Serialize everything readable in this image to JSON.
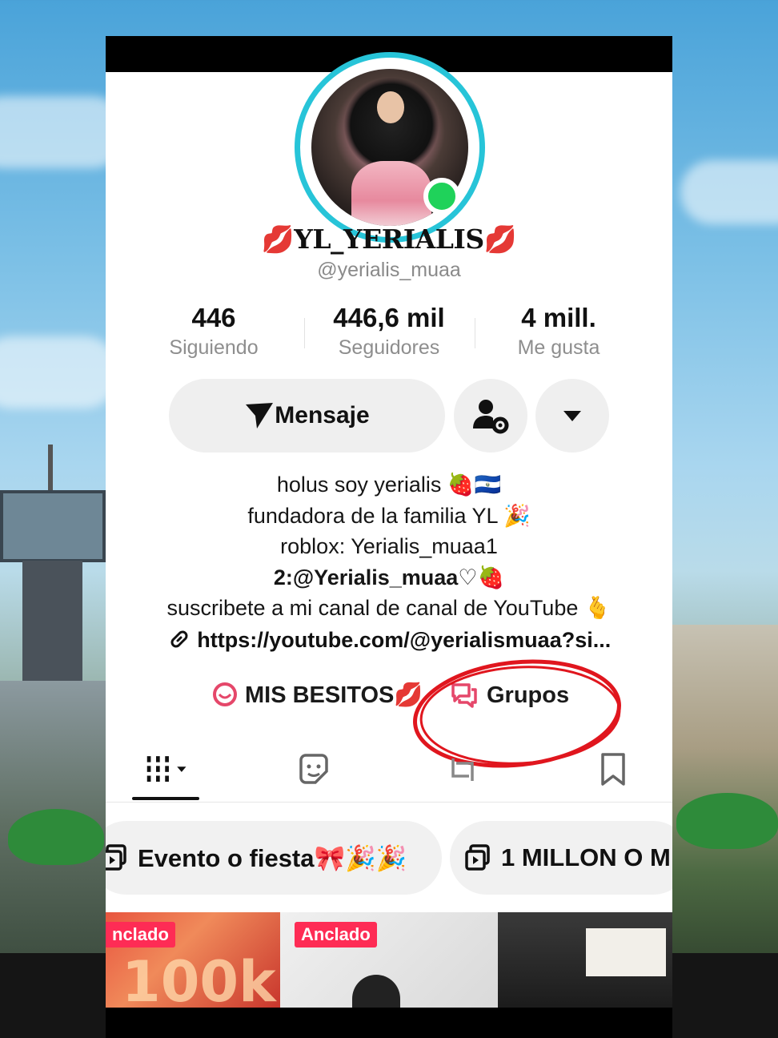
{
  "profile": {
    "display_name": "💋YL_YERIALIS💋",
    "username": "@yerialis_muaa"
  },
  "stats": [
    {
      "value": "446",
      "label": "Siguiendo"
    },
    {
      "value": "446,6 mil",
      "label": "Seguidores"
    },
    {
      "value": "4 mill.",
      "label": "Me gusta"
    }
  ],
  "actions": {
    "message_label": "Mensaje",
    "add_friend_icon": "user-gear-icon",
    "more_icon": "caret-down-icon"
  },
  "bio": [
    "holus soy yerialis 🍓🇸🇻",
    "fundadora de la familia YL 🎉",
    "roblox: Yerialis_muaa1",
    "2:@Yerialis_muaa♡🍓",
    "suscribete a mi canal de canal de YouTube 🫰"
  ],
  "link": "https://youtube.com/@yerialismuaa?si...",
  "chips": {
    "besitos_label": "MIS BESITOS💋",
    "grupos_label": "Grupos"
  },
  "tabs": [
    "videos-grid",
    "favorites",
    "reposts",
    "saved"
  ],
  "playlists": [
    {
      "label": "Evento o fiesta🎀🎉🎉"
    },
    {
      "label": "1 MILLON O M"
    }
  ],
  "videos": [
    {
      "pinned_label": "nclado"
    },
    {
      "pinned_label": "Anclado"
    },
    {
      "pinned_label": ""
    }
  ],
  "colors": {
    "ring": "#27c4d8",
    "online": "#1fd25a",
    "pinned": "#fe2c55",
    "annotation": "#e0161e"
  }
}
